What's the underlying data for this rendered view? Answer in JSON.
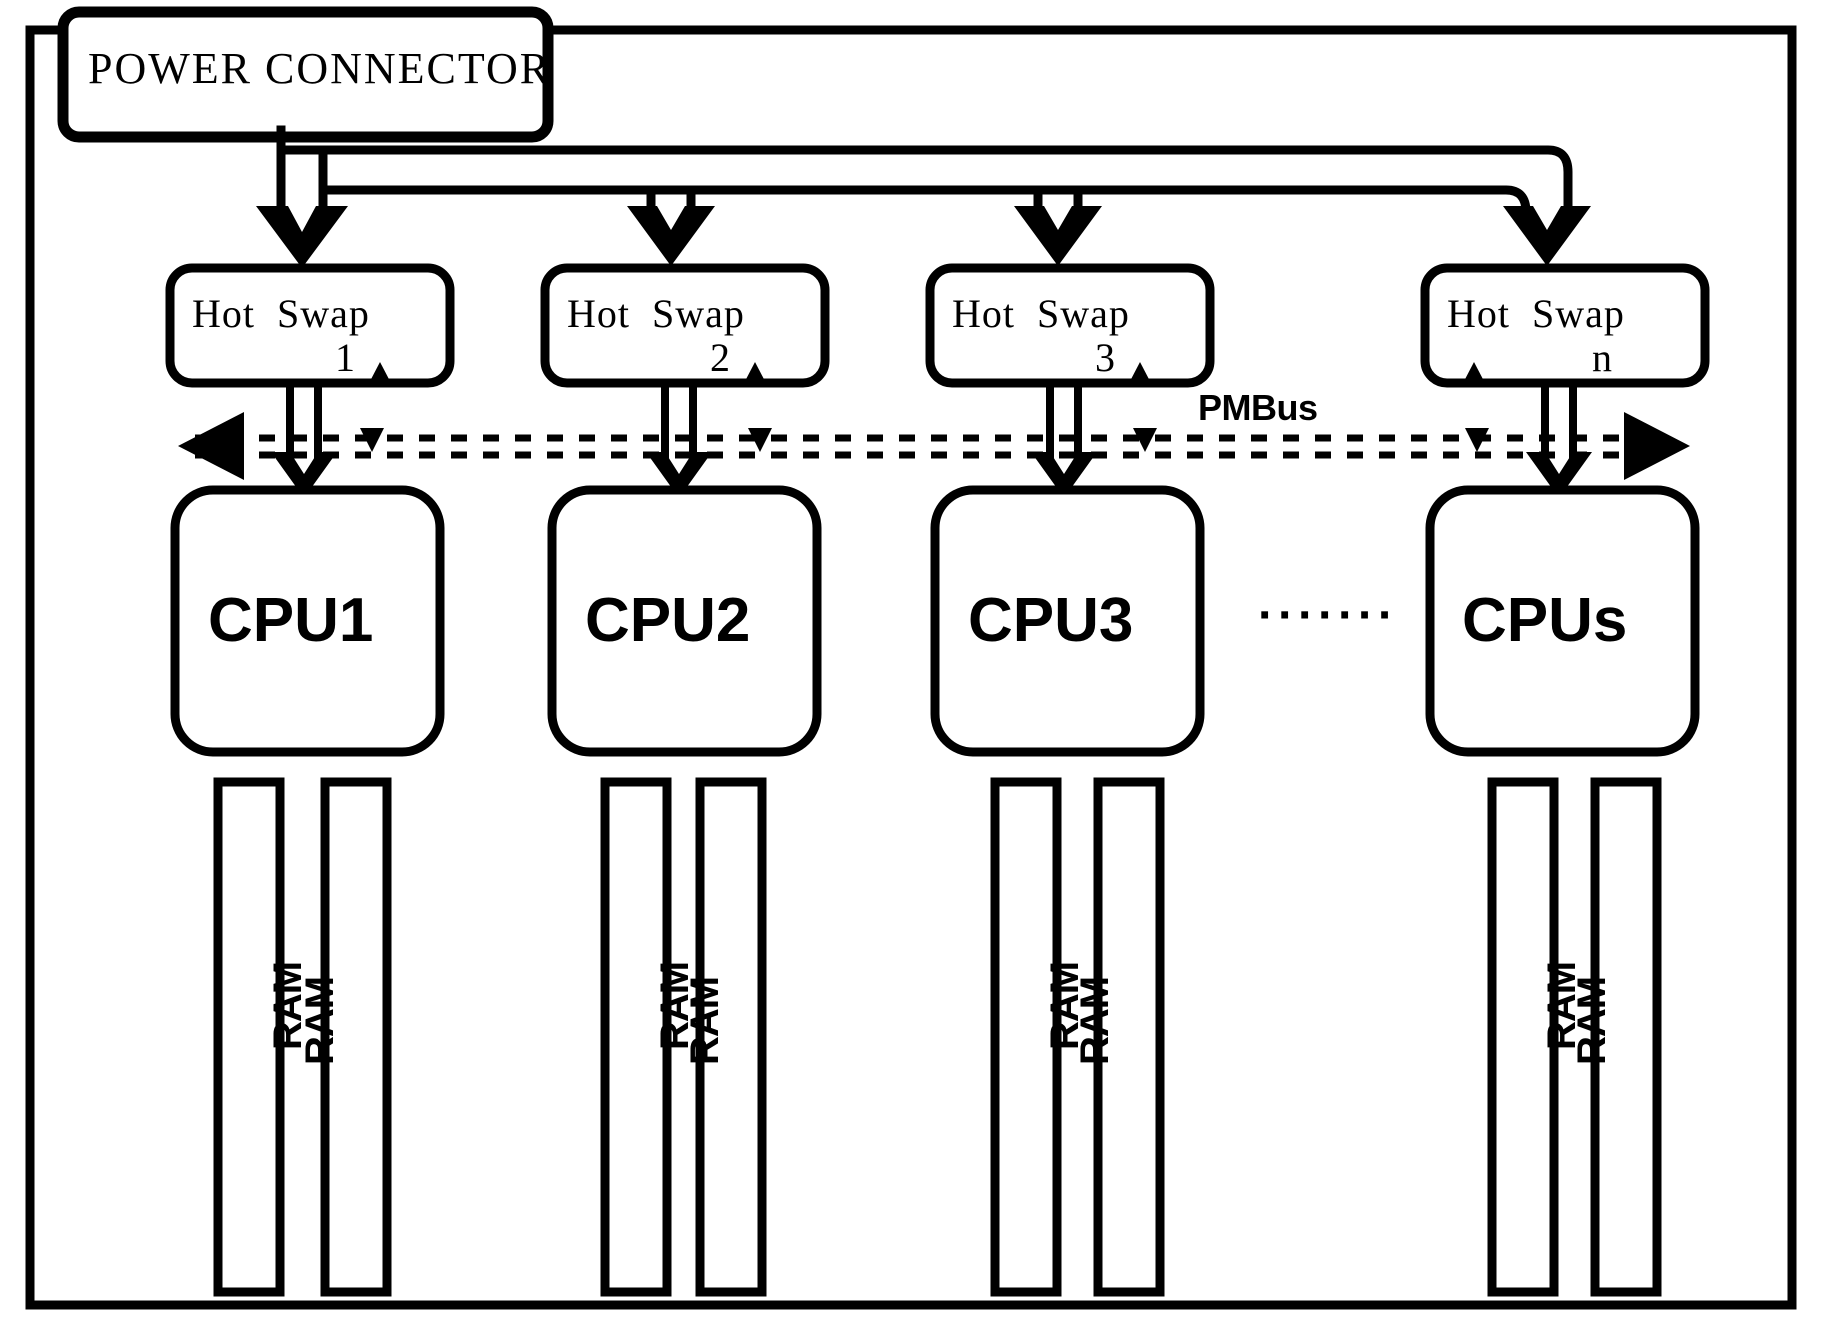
{
  "diagram": {
    "title_block": {
      "label": "POWER CONNECTOR"
    },
    "hot_swaps": [
      {
        "name": "hot-swap-1",
        "label": "Hot  Swap",
        "number": "1"
      },
      {
        "name": "hot-swap-2",
        "label": "Hot  Swap",
        "number": "2"
      },
      {
        "name": "hot-swap-3",
        "label": "Hot  Swap",
        "number": "3"
      },
      {
        "name": "hot-swap-n",
        "label": "Hot  Swap",
        "number": "n"
      }
    ],
    "bus": {
      "label": "PMBus"
    },
    "cpus": [
      {
        "name": "cpu-1",
        "label": "CPU1"
      },
      {
        "name": "cpu-2",
        "label": "CPU2"
      },
      {
        "name": "cpu-3",
        "label": "CPU3"
      },
      {
        "name": "cpu-s",
        "label": "CPUs"
      }
    ],
    "ellipsis": "·······",
    "ram_label": "RAM",
    "ram_groups": [
      {
        "name": "ram-group-1",
        "labels": [
          "RAM",
          "RAM"
        ]
      },
      {
        "name": "ram-group-2",
        "labels": [
          "RAM",
          "RAM"
        ]
      },
      {
        "name": "ram-group-3",
        "labels": [
          "RAM",
          "RAM"
        ]
      },
      {
        "name": "ram-group-n",
        "labels": [
          "RAM",
          "RAM"
        ]
      }
    ],
    "colors": {
      "stroke": "#000000",
      "background": "#ffffff"
    }
  }
}
